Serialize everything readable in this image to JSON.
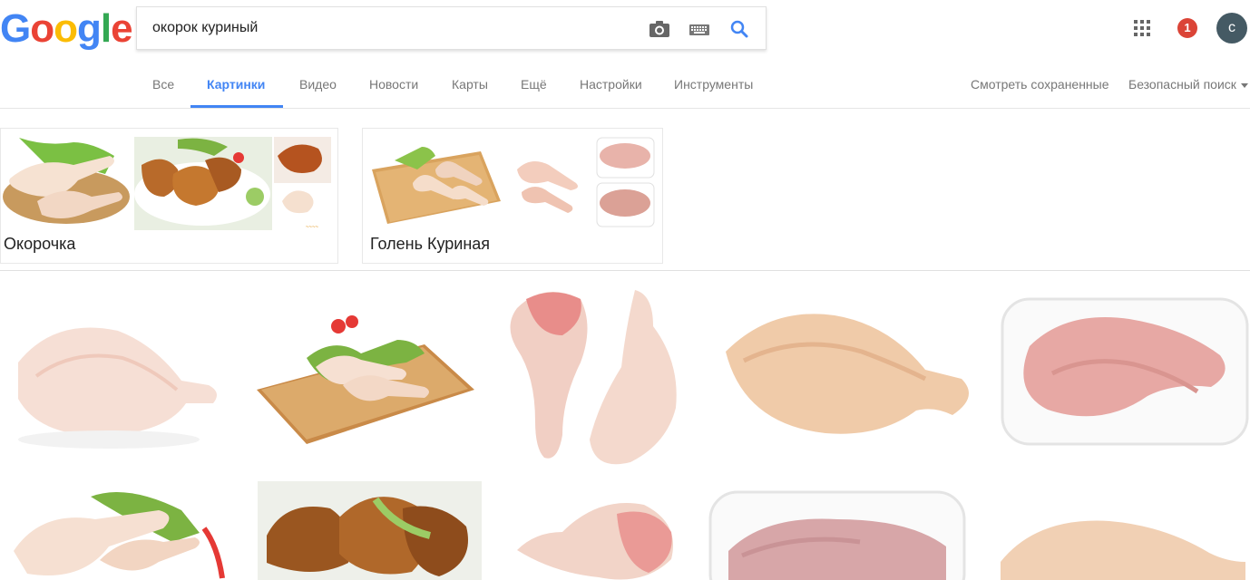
{
  "logo": {
    "letters": [
      "G",
      "o",
      "o",
      "g",
      "l",
      "e"
    ],
    "colors": [
      "#4285f4",
      "#ea4335",
      "#fbbc05",
      "#4285f4",
      "#34a853",
      "#ea4335"
    ]
  },
  "search": {
    "query": "окорок куриный",
    "icons": [
      "camera-icon",
      "keyboard-icon",
      "search-icon"
    ]
  },
  "header": {
    "notification_count": "1",
    "avatar_letter": "с",
    "apps_icon": "apps-grid-icon"
  },
  "tabs": [
    {
      "label": "Все",
      "active": false
    },
    {
      "label": "Картинки",
      "active": true
    },
    {
      "label": "Видео",
      "active": false
    },
    {
      "label": "Новости",
      "active": false
    },
    {
      "label": "Карты",
      "active": false
    },
    {
      "label": "Ещё",
      "active": false
    },
    {
      "label": "Настройки",
      "active": false
    },
    {
      "label": "Инструменты",
      "active": false
    }
  ],
  "right_links": {
    "saved": "Смотреть сохраненные",
    "safe_search": "Безопасный поиск"
  },
  "related": [
    {
      "label": "Окорочка"
    },
    {
      "label": "Голень Куриная"
    }
  ],
  "results_count": 10,
  "colors": {
    "accent": "#4285f4",
    "badge": "#db4437",
    "avatar": "#455a64"
  }
}
